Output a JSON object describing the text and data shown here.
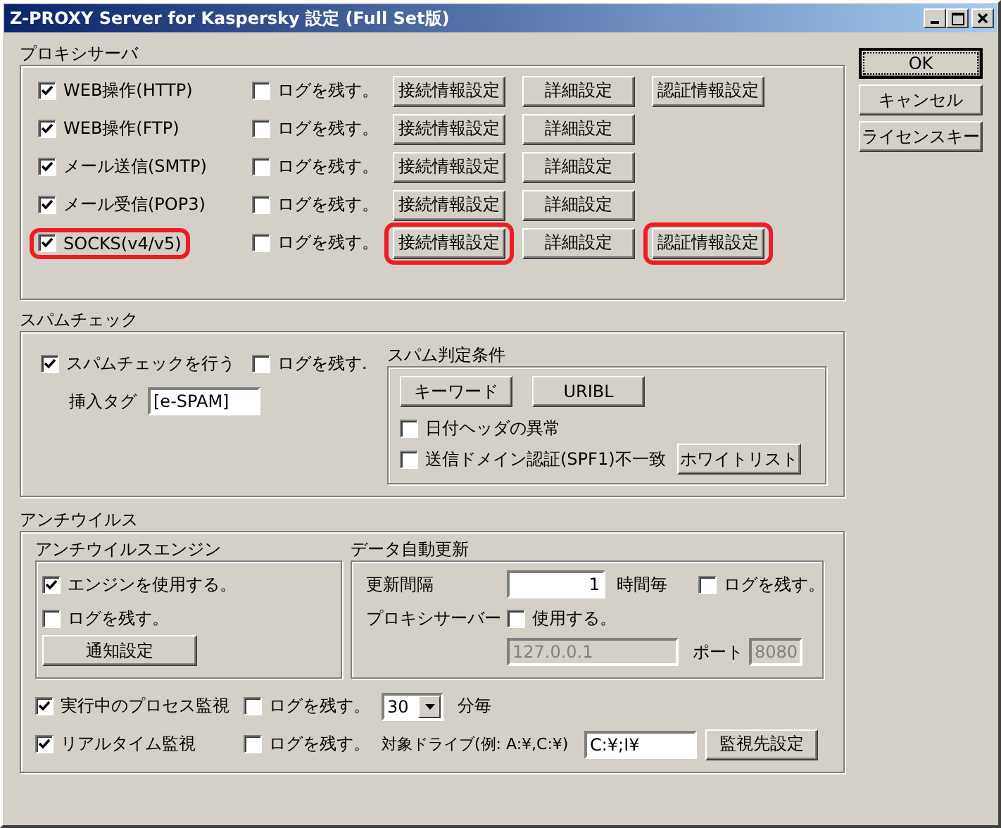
{
  "window": {
    "title": "Z-PROXY Server for Kaspersky 設定 (Full Set版)"
  },
  "side_buttons": [
    {
      "label": "OK",
      "focused": true
    },
    {
      "label": "キャンセル",
      "focused": false
    },
    {
      "label": "ライセンスキー",
      "focused": false
    }
  ],
  "proxy": {
    "title": "プロキシサーバ",
    "rows": [
      {
        "label": "WEB操作(HTTP)",
        "checked": true,
        "highlighted": false,
        "log": {
          "label": "ログを残す。",
          "checked": false
        },
        "buttons": [
          {
            "label": "接続情報設定",
            "highlighted": false
          },
          {
            "label": "詳細設定",
            "highlighted": false
          },
          {
            "label": "認証情報設定",
            "highlighted": false
          }
        ]
      },
      {
        "label": "WEB操作(FTP)",
        "checked": true,
        "highlighted": false,
        "log": {
          "label": "ログを残す。",
          "checked": false
        },
        "buttons": [
          {
            "label": "接続情報設定",
            "highlighted": false
          },
          {
            "label": "詳細設定",
            "highlighted": false
          }
        ]
      },
      {
        "label": "メール送信(SMTP)",
        "checked": true,
        "highlighted": false,
        "log": {
          "label": "ログを残す。",
          "checked": false
        },
        "buttons": [
          {
            "label": "接続情報設定",
            "highlighted": false
          },
          {
            "label": "詳細設定",
            "highlighted": false
          }
        ]
      },
      {
        "label": "メール受信(POP3)",
        "checked": true,
        "highlighted": false,
        "log": {
          "label": "ログを残す。",
          "checked": false
        },
        "buttons": [
          {
            "label": "接続情報設定",
            "highlighted": false
          },
          {
            "label": "詳細設定",
            "highlighted": false
          }
        ]
      },
      {
        "label": "SOCKS(v4/v5)",
        "checked": true,
        "highlighted": true,
        "log": {
          "label": "ログを残す。",
          "checked": false
        },
        "buttons": [
          {
            "label": "接続情報設定",
            "highlighted": true
          },
          {
            "label": "詳細設定",
            "highlighted": false
          },
          {
            "label": "認証情報設定",
            "highlighted": true
          }
        ]
      }
    ]
  },
  "spam": {
    "title": "スパムチェック",
    "enable": {
      "label": "スパムチェックを行う",
      "checked": true
    },
    "log": {
      "label": "ログを残す.",
      "checked": false
    },
    "tag_label": "挿入タグ",
    "tag_value": "[e-SPAM]",
    "criteria": {
      "title": "スパム判定条件",
      "buttons": [
        "キーワード",
        "URIBL"
      ],
      "date_check": {
        "label": "日付ヘッダの異常",
        "checked": false
      },
      "spf_check": {
        "label": "送信ドメイン認証(SPF1)不一致",
        "checked": false
      },
      "whitelist_button": "ホワイトリスト"
    }
  },
  "antivirus": {
    "title": "アンチウイルス",
    "engine": {
      "title": "アンチウイルスエンジン",
      "use": {
        "label": "エンジンを使用する。",
        "checked": true
      },
      "log": {
        "label": "ログを残す。",
        "checked": false
      },
      "notify_button": "通知設定"
    },
    "update": {
      "title": "データ自動更新",
      "interval_label": "更新間隔",
      "interval_value": "1",
      "interval_unit": "時間毎",
      "log": {
        "label": "ログを残す。",
        "checked": false
      },
      "proxy_label": "プロキシサーバー",
      "proxy_use": {
        "label": "使用する。",
        "checked": false
      },
      "host_value": "127.0.0.1",
      "port_label": "ポート",
      "port_value": "8080",
      "fields_disabled": true
    },
    "process": {
      "label": "実行中のプロセス監視",
      "checked": true
    },
    "process_log": {
      "label": "ログを残す。",
      "checked": false
    },
    "interval_select": "30",
    "interval_unit": "分毎",
    "realtime": {
      "label": "リアルタイム監視",
      "checked": true
    },
    "realtime_log": {
      "label": "ログを残す。",
      "checked": false
    },
    "drive_label": "対象ドライブ(例: A:¥,C:¥)",
    "drive_value": "C:¥;I¥",
    "monitor_button": "監視先設定"
  }
}
